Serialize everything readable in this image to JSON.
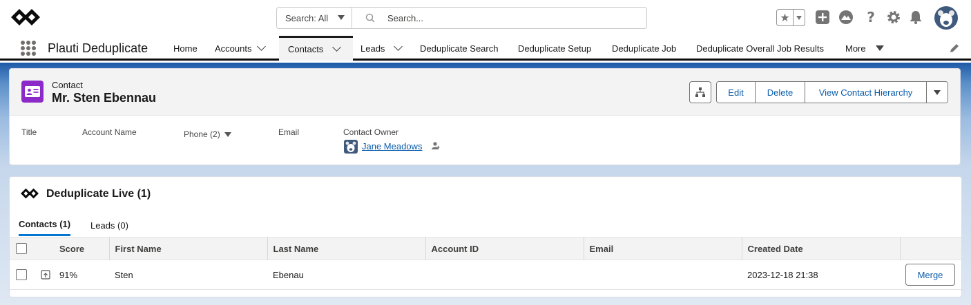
{
  "header": {
    "search_scope": "Search: All",
    "search_placeholder": "Search..."
  },
  "nav": {
    "app_name": "Plauti Deduplicate",
    "items": [
      {
        "label": "Home"
      },
      {
        "label": "Accounts"
      },
      {
        "label": "Contacts"
      },
      {
        "label": "Leads"
      },
      {
        "label": "Deduplicate Search"
      },
      {
        "label": "Deduplicate Setup"
      },
      {
        "label": "Deduplicate Job"
      },
      {
        "label": "Deduplicate Overall Job Results"
      },
      {
        "label": "More"
      }
    ],
    "active": "Contacts"
  },
  "record": {
    "type": "Contact",
    "name": "Mr. Sten Ebennau",
    "buttons": {
      "edit": "Edit",
      "delete": "Delete",
      "hierarchy": "View Contact Hierarchy"
    },
    "fields": {
      "title": "Title",
      "account_name": "Account Name",
      "phone": "Phone (2)",
      "email": "Email",
      "owner_label": "Contact Owner",
      "owner_value": "Jane Meadows"
    }
  },
  "dedupe": {
    "title": "Deduplicate Live (1)",
    "tabs": [
      "Contacts (1)",
      "Leads (0)"
    ],
    "columns": [
      "Score",
      "First Name",
      "Last Name",
      "Account ID",
      "Email",
      "Created Date"
    ],
    "rows": [
      {
        "score": "91%",
        "first_name": "Sten",
        "last_name": "Ebenau",
        "account_id": "",
        "email": "",
        "created": "2023-12-18 21:38",
        "action": "Merge"
      }
    ]
  },
  "colors": {
    "brand_blue": "#0b5cab",
    "tab_accent": "#0176d3",
    "contact_icon": "#8b2ac9"
  }
}
